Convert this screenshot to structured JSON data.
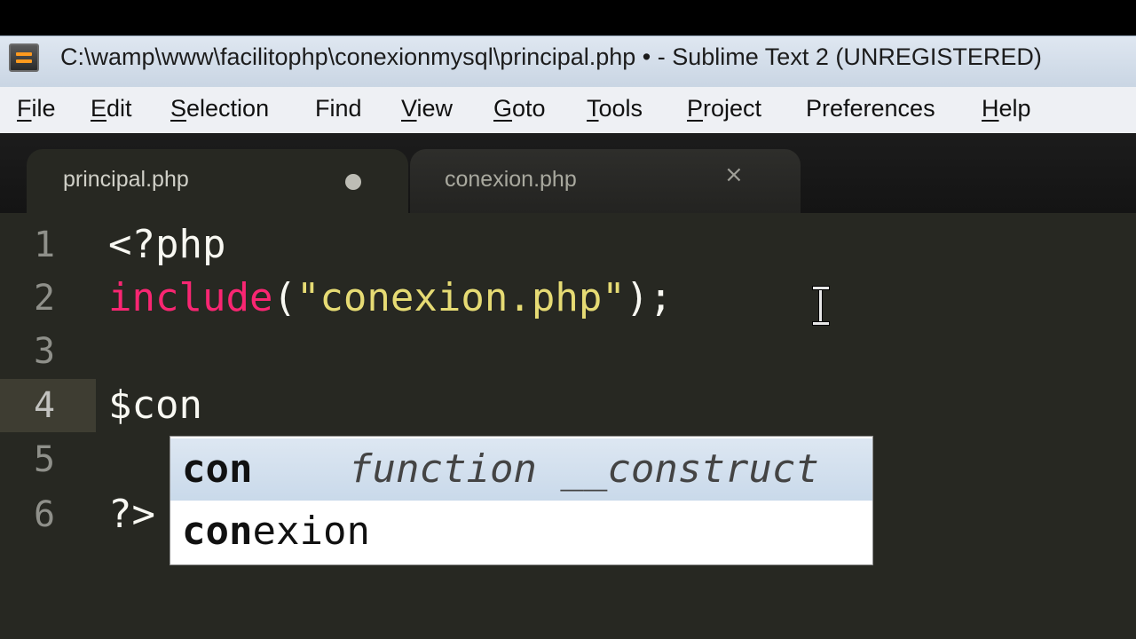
{
  "window": {
    "title": "C:\\wamp\\www\\facilitophp\\conexionmysql\\principal.php • - Sublime Text 2 (UNREGISTERED)",
    "app_icon": "sublime-text-icon"
  },
  "menu": {
    "items": [
      {
        "label": "File",
        "underline": "F",
        "rest": "ile"
      },
      {
        "label": "Edit",
        "underline": "E",
        "rest": "dit"
      },
      {
        "label": "Selection",
        "underline": "S",
        "rest": "election"
      },
      {
        "label": "Find",
        "underline": "",
        "rest": "Find"
      },
      {
        "label": "View",
        "underline": "V",
        "rest": "iew"
      },
      {
        "label": "Goto",
        "underline": "G",
        "rest": "oto"
      },
      {
        "label": "Tools",
        "underline": "T",
        "rest": "ools"
      },
      {
        "label": "Project",
        "underline": "P",
        "rest": "roject"
      },
      {
        "label": "Preferences",
        "underline": "",
        "rest": "Preferences"
      },
      {
        "label": "Help",
        "underline": "H",
        "rest": "elp"
      }
    ]
  },
  "tabs": [
    {
      "label": "principal.php",
      "active": true,
      "modified": true
    },
    {
      "label": "conexion.php",
      "active": false,
      "close_glyph": "×"
    }
  ],
  "editor": {
    "current_line": 4,
    "lines": [
      {
        "num": "1",
        "tokens": [
          {
            "text": "<?php",
            "kind": "plain"
          }
        ]
      },
      {
        "num": "2",
        "tokens": [
          {
            "text": "include",
            "kind": "kw"
          },
          {
            "text": "(",
            "kind": "plain"
          },
          {
            "text": "\"conexion.php\"",
            "kind": "str"
          },
          {
            "text": ");",
            "kind": "plain"
          }
        ]
      },
      {
        "num": "3",
        "tokens": []
      },
      {
        "num": "4",
        "tokens": [
          {
            "text": "$con",
            "kind": "plain"
          }
        ]
      },
      {
        "num": "5",
        "tokens": []
      },
      {
        "num": "6",
        "tokens": [
          {
            "text": "?>",
            "kind": "plain"
          }
        ]
      }
    ]
  },
  "autocomplete": {
    "items": [
      {
        "trigger_bold": "con",
        "trigger_rest": "",
        "annotation": "function __construct",
        "selected": true
      },
      {
        "trigger_bold": "con",
        "trigger_rest": "exion",
        "annotation": "",
        "selected": false
      }
    ]
  },
  "colors": {
    "editor_bg": "#272822",
    "keyword": "#f92672",
    "string": "#e6db74",
    "text": "#f8f8f2",
    "line_number": "#8f908a"
  }
}
